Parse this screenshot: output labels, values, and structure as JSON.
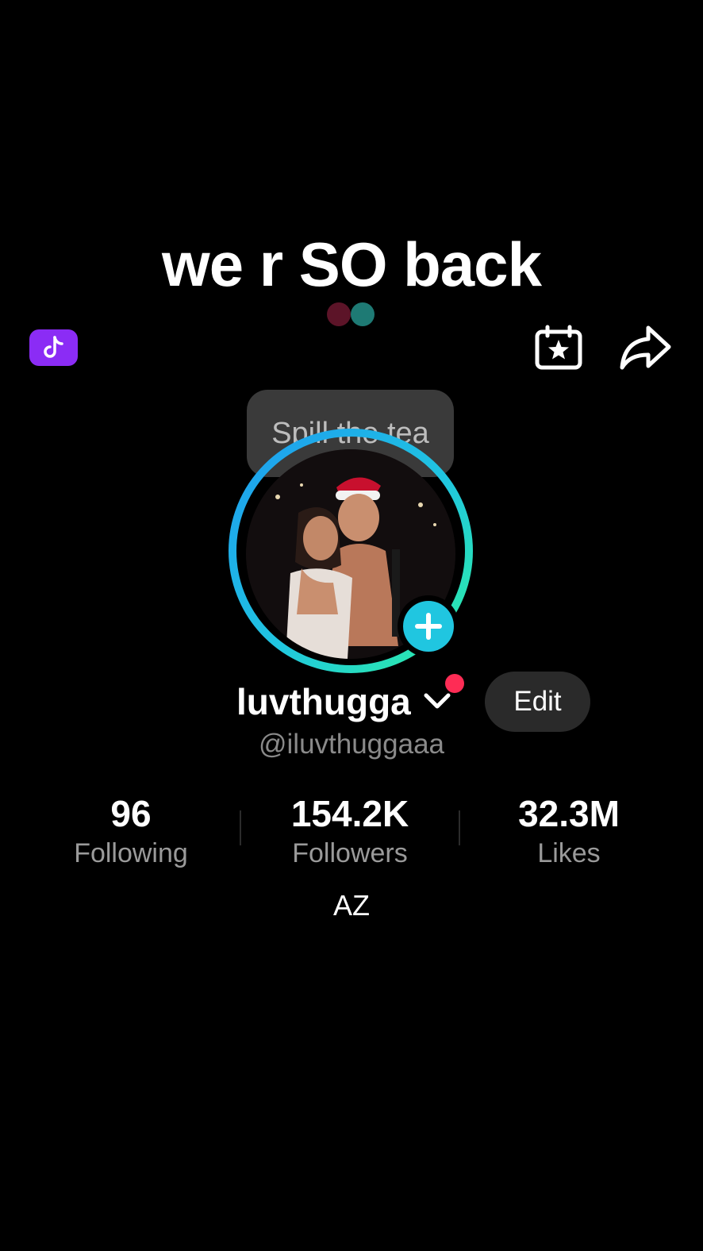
{
  "overlay": {
    "caption": "we r SO back"
  },
  "header": {
    "badge_icon": "tiktok-note-icon",
    "calendar_icon": "calendar-star-icon",
    "share_icon": "share-arrow-icon",
    "badge_color": "#8b2cf5"
  },
  "tooltip": {
    "text": "Spill the tea"
  },
  "profile": {
    "display_name": "luvthugga",
    "handle": "@iluvthuggaaa",
    "edit_label": "Edit",
    "bio": "AZ",
    "accent_color": "#20c6e0",
    "notification_color": "#fe2c55"
  },
  "stats": [
    {
      "value": "96",
      "label": "Following"
    },
    {
      "value": "154.2K",
      "label": "Followers"
    },
    {
      "value": "32.3M",
      "label": "Likes"
    }
  ]
}
